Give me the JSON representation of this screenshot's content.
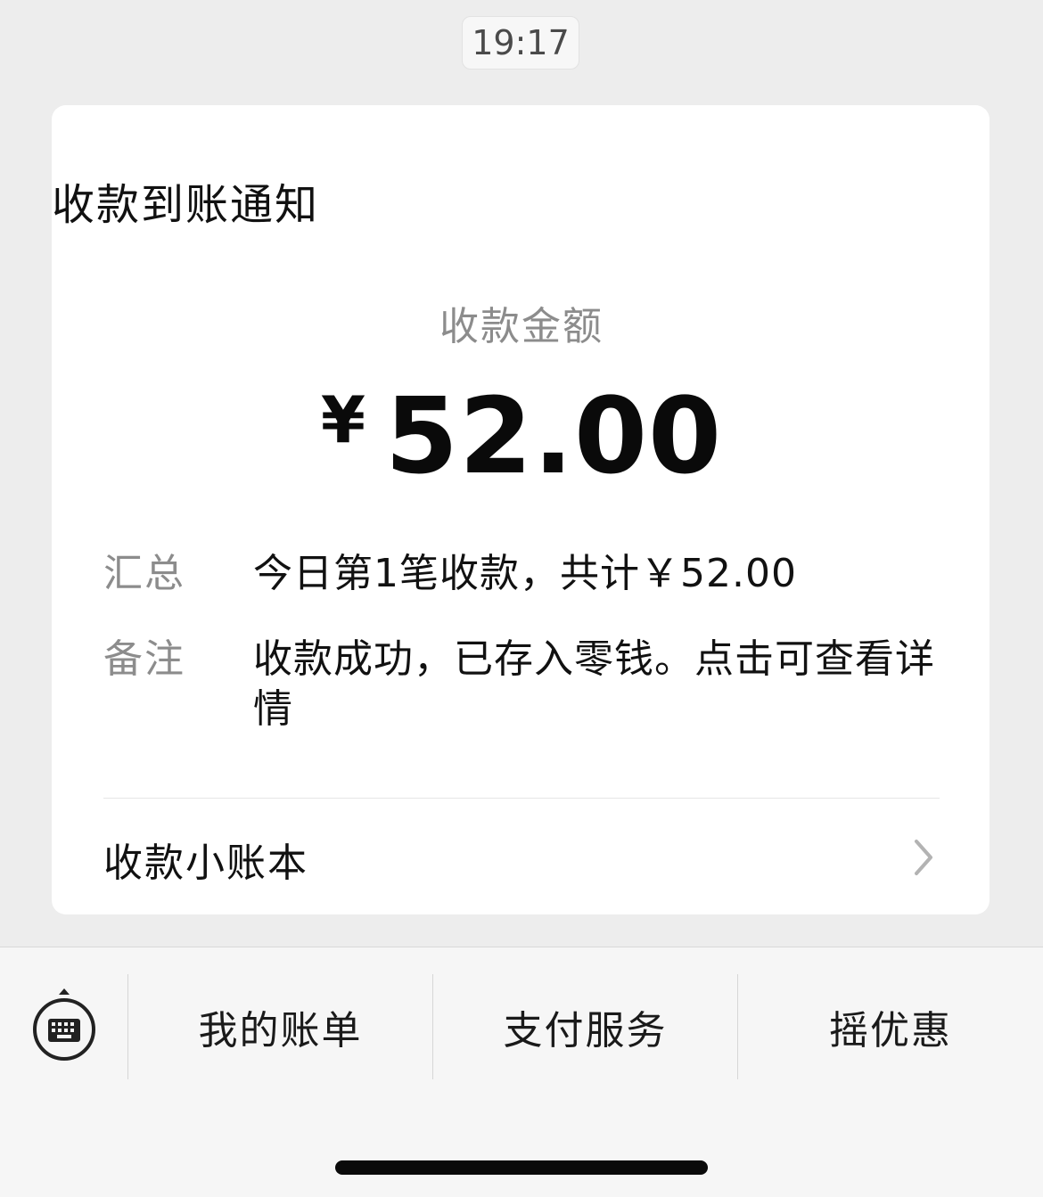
{
  "timestamp": "19:17",
  "card": {
    "title": "收款到账通知",
    "amount_label": "收款金额",
    "currency_symbol": "¥",
    "amount_value": "52.00",
    "summary": {
      "label": "汇总",
      "value": "今日第1笔收款，共计￥52.00"
    },
    "remark": {
      "label": "备注",
      "value": "收款成功，已存入零钱。点击可查看详情"
    },
    "ledger_link": "收款小账本"
  },
  "menu": {
    "items": [
      {
        "label": "我的账单"
      },
      {
        "label": "支付服务"
      },
      {
        "label": "摇优惠"
      }
    ]
  },
  "icons": {
    "keyboard": "keyboard-icon",
    "chevron": "chevron-right-icon"
  },
  "colors": {
    "background": "#ededed",
    "card": "#ffffff",
    "muted_text": "#8c8c8c",
    "bottom_bar": "#f6f6f6"
  }
}
